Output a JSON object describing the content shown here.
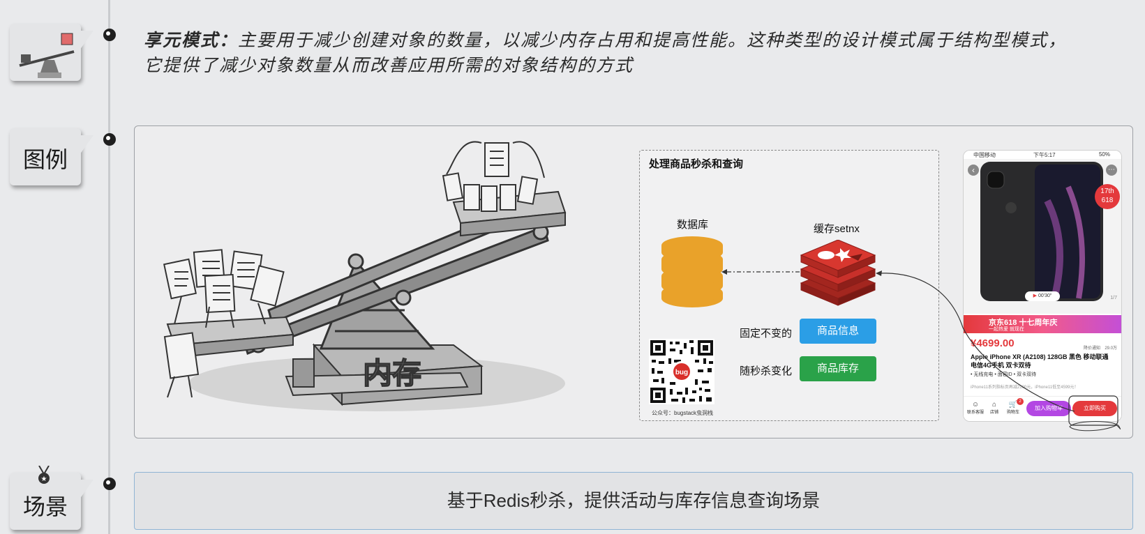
{
  "intro": {
    "title": "享元模式：",
    "text": "主要用于减少创建对象的数量，以减少内存占用和提高性能。这种类型的设计模式属于结构型模式，它提供了减少对象数量从而改善应用所需的对象结构的方式"
  },
  "tags": {
    "legend": "图例",
    "scene": "场景"
  },
  "illustration": {
    "memory_label": "内存"
  },
  "panel": {
    "title": "处理商品秒杀和查询",
    "db_label": "数据库",
    "cache_label": "缓存setnx",
    "fixed_label": "固定不变的",
    "fixed_pill": "商品信息",
    "change_label": "随秒杀变化",
    "change_pill": "商品库存",
    "qr_caption": "公众号：bugstack虫洞栈",
    "qr_badge": "bug"
  },
  "phone": {
    "carrier": "中国移动",
    "time": "下午5:17",
    "battery": "50%",
    "video_time": "00'30\"",
    "img_count": "1/7",
    "banner_text": "京东618 十七周年庆",
    "banner_sub": "一起热爱 就现在",
    "badge_top": "17th",
    "badge_bottom": "618",
    "price": "¥4699.00",
    "notify_label": "降价通知",
    "follow_count": "29.0万",
    "title": "Apple iPhone XR (A2108) 128GB 黑色 移动联通电信4G手机 双卡双待",
    "features": "• 无线充电 • 面容ID • 双卡双待",
    "note": "iPhone11系列指标页再减2100元，iPhone11低至4599元！",
    "bottom": [
      "联系客服",
      "店铺",
      "购物车"
    ],
    "cart_badge": "2",
    "add_cart": "加入购物车",
    "buy_now": "立即购买"
  },
  "scene": {
    "text": "基于Redis秒杀，提供活动与库存信息查询场景"
  },
  "colors": {
    "redis_red": "#c8302a",
    "db_orange": "#e9a22a",
    "pill_blue": "#2b9ee6",
    "pill_green": "#2aa249",
    "buy_red": "#e4393c",
    "cart_purple": "#b347e3"
  }
}
